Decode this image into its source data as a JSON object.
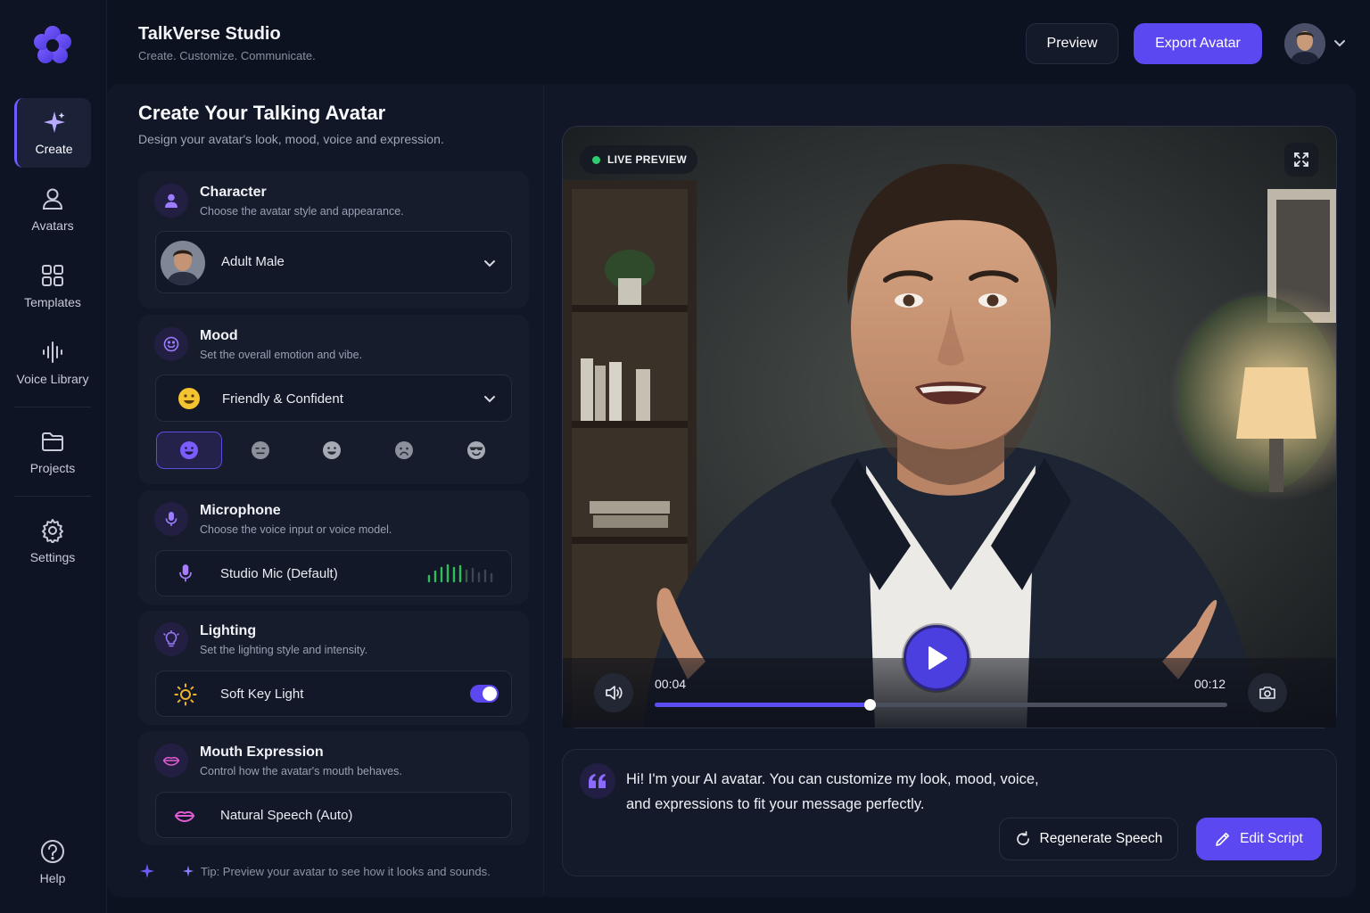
{
  "app": {
    "title": "TalkVerse Studio",
    "subtitle": "Create. Customize. Communicate."
  },
  "header": {
    "preview_label": "Preview",
    "export_label": "Export Avatar"
  },
  "sidebar": {
    "items": [
      {
        "label": "Create",
        "icon": "sparkle-icon",
        "active": true
      },
      {
        "label": "Avatars",
        "icon": "user-icon"
      },
      {
        "label": "Templates",
        "icon": "grid-icon"
      },
      {
        "label": "Voice Library",
        "icon": "waveform-icon"
      },
      {
        "label": "Projects",
        "icon": "folder-icon"
      },
      {
        "label": "Settings",
        "icon": "gear-icon"
      }
    ],
    "help_label": "Help"
  },
  "page": {
    "title": "Create Your Talking Avatar",
    "subtitle": "Design your avatar's look, mood, voice and expression."
  },
  "character": {
    "title": "Character",
    "description": "Choose the avatar style and appearance.",
    "selected": "Adult Male"
  },
  "mood": {
    "title": "Mood",
    "description": "Set the overall emotion and vibe.",
    "selected": "Friendly & Confident",
    "options": [
      "happy",
      "neutral",
      "smile",
      "sad",
      "cool"
    ],
    "active_index": 0
  },
  "microphone": {
    "title": "Microphone",
    "description": "Choose the voice input or voice model.",
    "selected": "Studio Mic (Default)"
  },
  "lighting": {
    "title": "Lighting",
    "description": "Set the lighting style and intensity.",
    "selected": "Soft Key Light",
    "enabled": true
  },
  "mouth": {
    "title": "Mouth Expression",
    "description": "Control how the avatar's mouth behaves.",
    "selected": "Natural Speech (Auto)"
  },
  "tip": "Tip: Preview your avatar to see how it looks and sounds.",
  "preview": {
    "badge": "LIVE PREVIEW",
    "current_time": "00:04",
    "total_time": "00:12",
    "progress": 0.375
  },
  "script": {
    "line1": "Hi! I'm your AI avatar. You can customize my look, mood, voice,",
    "line2": "and expressions to fit your message perfectly.",
    "regenerate_label": "Regenerate Speech",
    "edit_label": "Edit Script"
  },
  "colors": {
    "accent": "#5b48f0",
    "background": "#0d1220",
    "live": "#2ecc71"
  }
}
